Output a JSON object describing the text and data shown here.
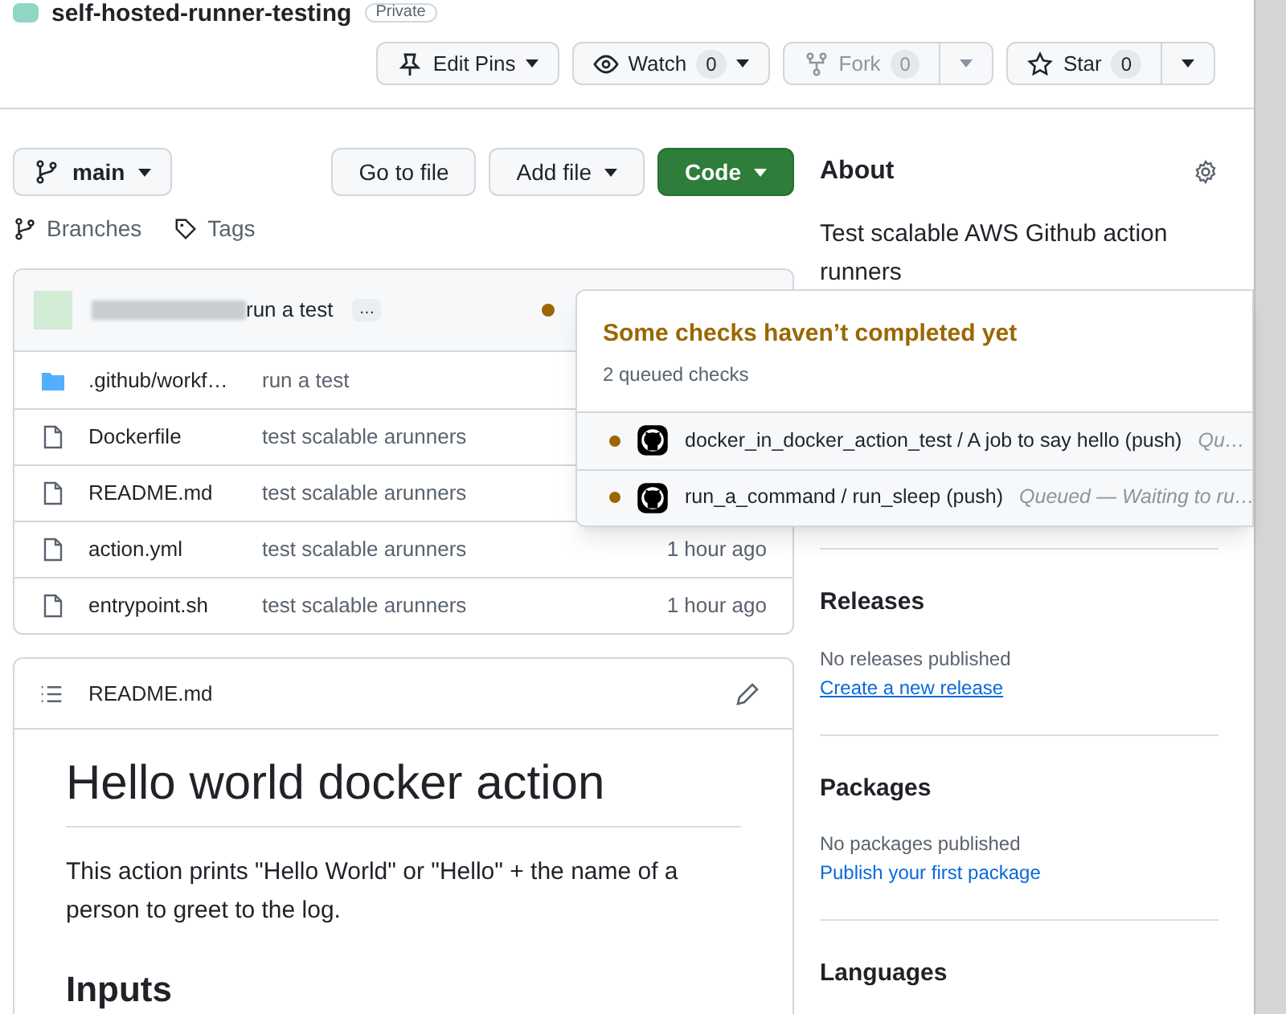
{
  "repo": {
    "title": "self-hosted-runner-testing",
    "visibility": "Private"
  },
  "header_actions": [
    {
      "kind": "pin",
      "label": "Edit Pins",
      "disabled": false
    },
    {
      "kind": "watch",
      "label": "Watch",
      "count": "0",
      "disabled": false
    },
    {
      "kind": "fork",
      "label": "Fork",
      "count": "0",
      "disabled": true
    },
    {
      "kind": "star",
      "label": "Star",
      "count": "0",
      "disabled": false
    }
  ],
  "branch": "main",
  "ref_links": [
    {
      "kind": "branches",
      "label": "Branches"
    },
    {
      "kind": "tags",
      "label": "Tags"
    }
  ],
  "file_buttons": [
    {
      "kind": "plain",
      "label": "Go to file"
    },
    {
      "kind": "menu",
      "label": "Add file"
    },
    {
      "kind": "primary",
      "label": "Code"
    }
  ],
  "latest_commit": {
    "message": "run a test",
    "more": "…",
    "pending": true
  },
  "files": [
    {
      "kind": "folder",
      "name": ".github/workf…",
      "message": "run a test"
    },
    {
      "kind": "file",
      "name": "Dockerfile",
      "message": "test scalable arunners"
    },
    {
      "kind": "file",
      "name": "README.md",
      "message": "test scalable arunners"
    },
    {
      "kind": "file",
      "name": "action.yml",
      "message": "test scalable arunners",
      "time": "1 hour ago"
    },
    {
      "kind": "file",
      "name": "entrypoint.sh",
      "message": "test scalable arunners",
      "time": "1 hour ago"
    }
  ],
  "readme": {
    "filename": "README.md",
    "heading": "Hello world docker action",
    "paragraph": "This action prints \"Hello World\" or \"Hello\" + the name of a person to greet to the log.",
    "subheading": "Inputs"
  },
  "about": {
    "title": "About",
    "description": "Test scalable AWS Github action runners"
  },
  "sidebar_sections": [
    {
      "title": "Releases",
      "note": "No releases published",
      "link": "Create a new release",
      "underlined": true
    },
    {
      "title": "Packages",
      "note": "No packages published",
      "link": "Publish your first package",
      "underlined": false
    },
    {
      "title": "Languages"
    }
  ],
  "checks_popover": {
    "title": "Some checks haven’t completed yet",
    "subtitle": "2 queued checks",
    "checks": [
      {
        "name": "docker_in_docker_action_test / A job to say hello (push)",
        "status": "Qu…",
        "pending": true
      },
      {
        "name": "run_a_command / run_sleep (push)",
        "status": "Queued — Waiting to ru…",
        "pending": true
      }
    ]
  }
}
